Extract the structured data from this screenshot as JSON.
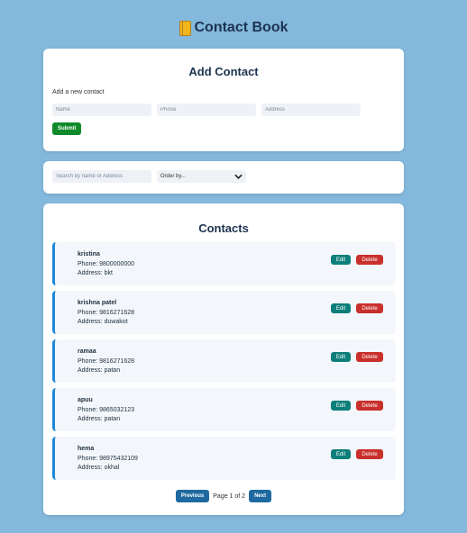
{
  "app": {
    "title": "Contact Book",
    "icon": "book-icon"
  },
  "add_contact": {
    "heading": "Add Contact",
    "subtext": "Add a new contact",
    "name_placeholder": "Name",
    "phone_placeholder": "Phone",
    "address_placeholder": "Address",
    "submit_label": "Submit"
  },
  "filter": {
    "search_placeholder": "Search by name or Address",
    "order_label": "Order by..."
  },
  "contacts": {
    "heading": "Contacts",
    "items": [
      {
        "name": "kristina",
        "phone": "Phone: 9800000000",
        "address": "Address: bkt"
      },
      {
        "name": "krishna patel",
        "phone": "Phone: 9816271628",
        "address": "Address: duwakot"
      },
      {
        "name": "ramaa",
        "phone": "Phone: 9816271628",
        "address": "Address: patan"
      },
      {
        "name": "apuu",
        "phone": "Phone: 9865032123",
        "address": "Address: patan"
      },
      {
        "name": "hema",
        "phone": "Phone: 98975432109",
        "address": "Address: okhal"
      }
    ],
    "edit_label": "Edit",
    "delete_label": "Delete"
  },
  "pagination": {
    "previous_label": "Previous",
    "page_text": "Page 1 of 2",
    "next_label": "Next"
  },
  "colors": {
    "background": "#84b8dc",
    "submit": "#0f8a2a",
    "edit": "#0d7f7a",
    "delete": "#c9302c",
    "accent": "#1e88d8"
  }
}
